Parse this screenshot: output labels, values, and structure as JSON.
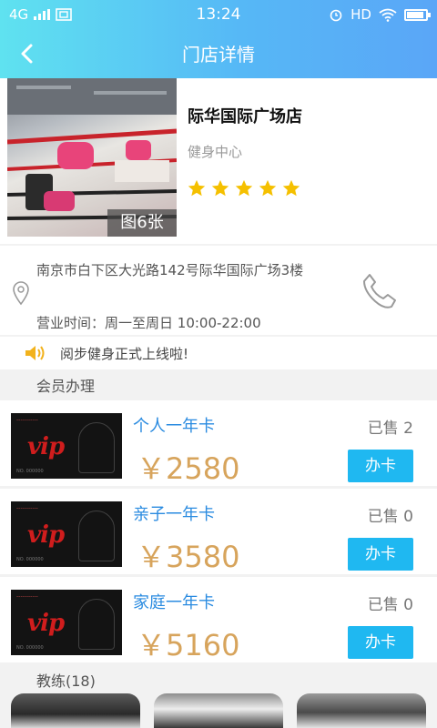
{
  "statusbar": {
    "network": "4G",
    "time": "13:24",
    "hd": "HD"
  },
  "nav": {
    "title": "门店详情"
  },
  "store": {
    "name": "际华国际广场店",
    "type": "健身中心",
    "photo_count": "图6张",
    "rating": 5,
    "address": "南京市白下区大光路142号际华国际广场3楼",
    "hours": "营业时间：周一至周日 10:00-22:00"
  },
  "notice": {
    "text": "阅步健身正式上线啦!"
  },
  "membership": {
    "title": "会员办理",
    "cards": [
      {
        "name": "个人一年卡",
        "sold": "已售 2",
        "price": "￥2580",
        "button": "办卡"
      },
      {
        "name": "亲子一年卡",
        "sold": "已售 0",
        "price": "￥3580",
        "button": "办卡"
      },
      {
        "name": "家庭一年卡",
        "sold": "已售 0",
        "price": "￥5160",
        "button": "办卡"
      }
    ]
  },
  "coaches": {
    "title": "教练(18)"
  },
  "colors": {
    "accent": "#1fb8f1",
    "price": "#d7a45c",
    "link": "#2a8be0",
    "star": "#f5c000"
  }
}
